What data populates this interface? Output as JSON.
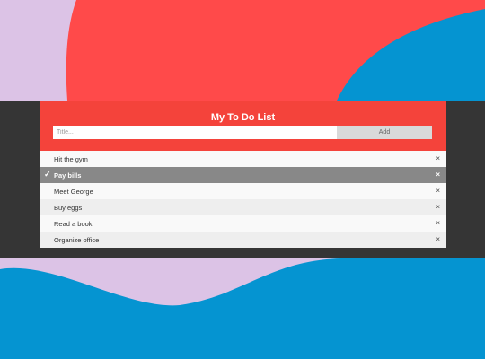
{
  "app": {
    "title": "My To Do List",
    "input_placeholder": "Title...",
    "add_label": "Add"
  },
  "items": [
    {
      "text": "Hit the gym",
      "checked": false,
      "close": "×"
    },
    {
      "text": "Pay bills",
      "checked": true,
      "check_icon": "✓",
      "close": "×"
    },
    {
      "text": "Meet George",
      "checked": false,
      "close": "×"
    },
    {
      "text": "Buy eggs",
      "checked": false,
      "close": "×"
    },
    {
      "text": "Read a book",
      "checked": false,
      "close": "×"
    },
    {
      "text": "Organize office",
      "checked": false,
      "close": "×"
    }
  ],
  "colors": {
    "header": "#f4433b",
    "band": "#353535",
    "checked_row": "#888888",
    "bg_pink": "#dcc3e6",
    "bg_red": "#ff4a4a",
    "bg_blue": "#0594d1"
  }
}
